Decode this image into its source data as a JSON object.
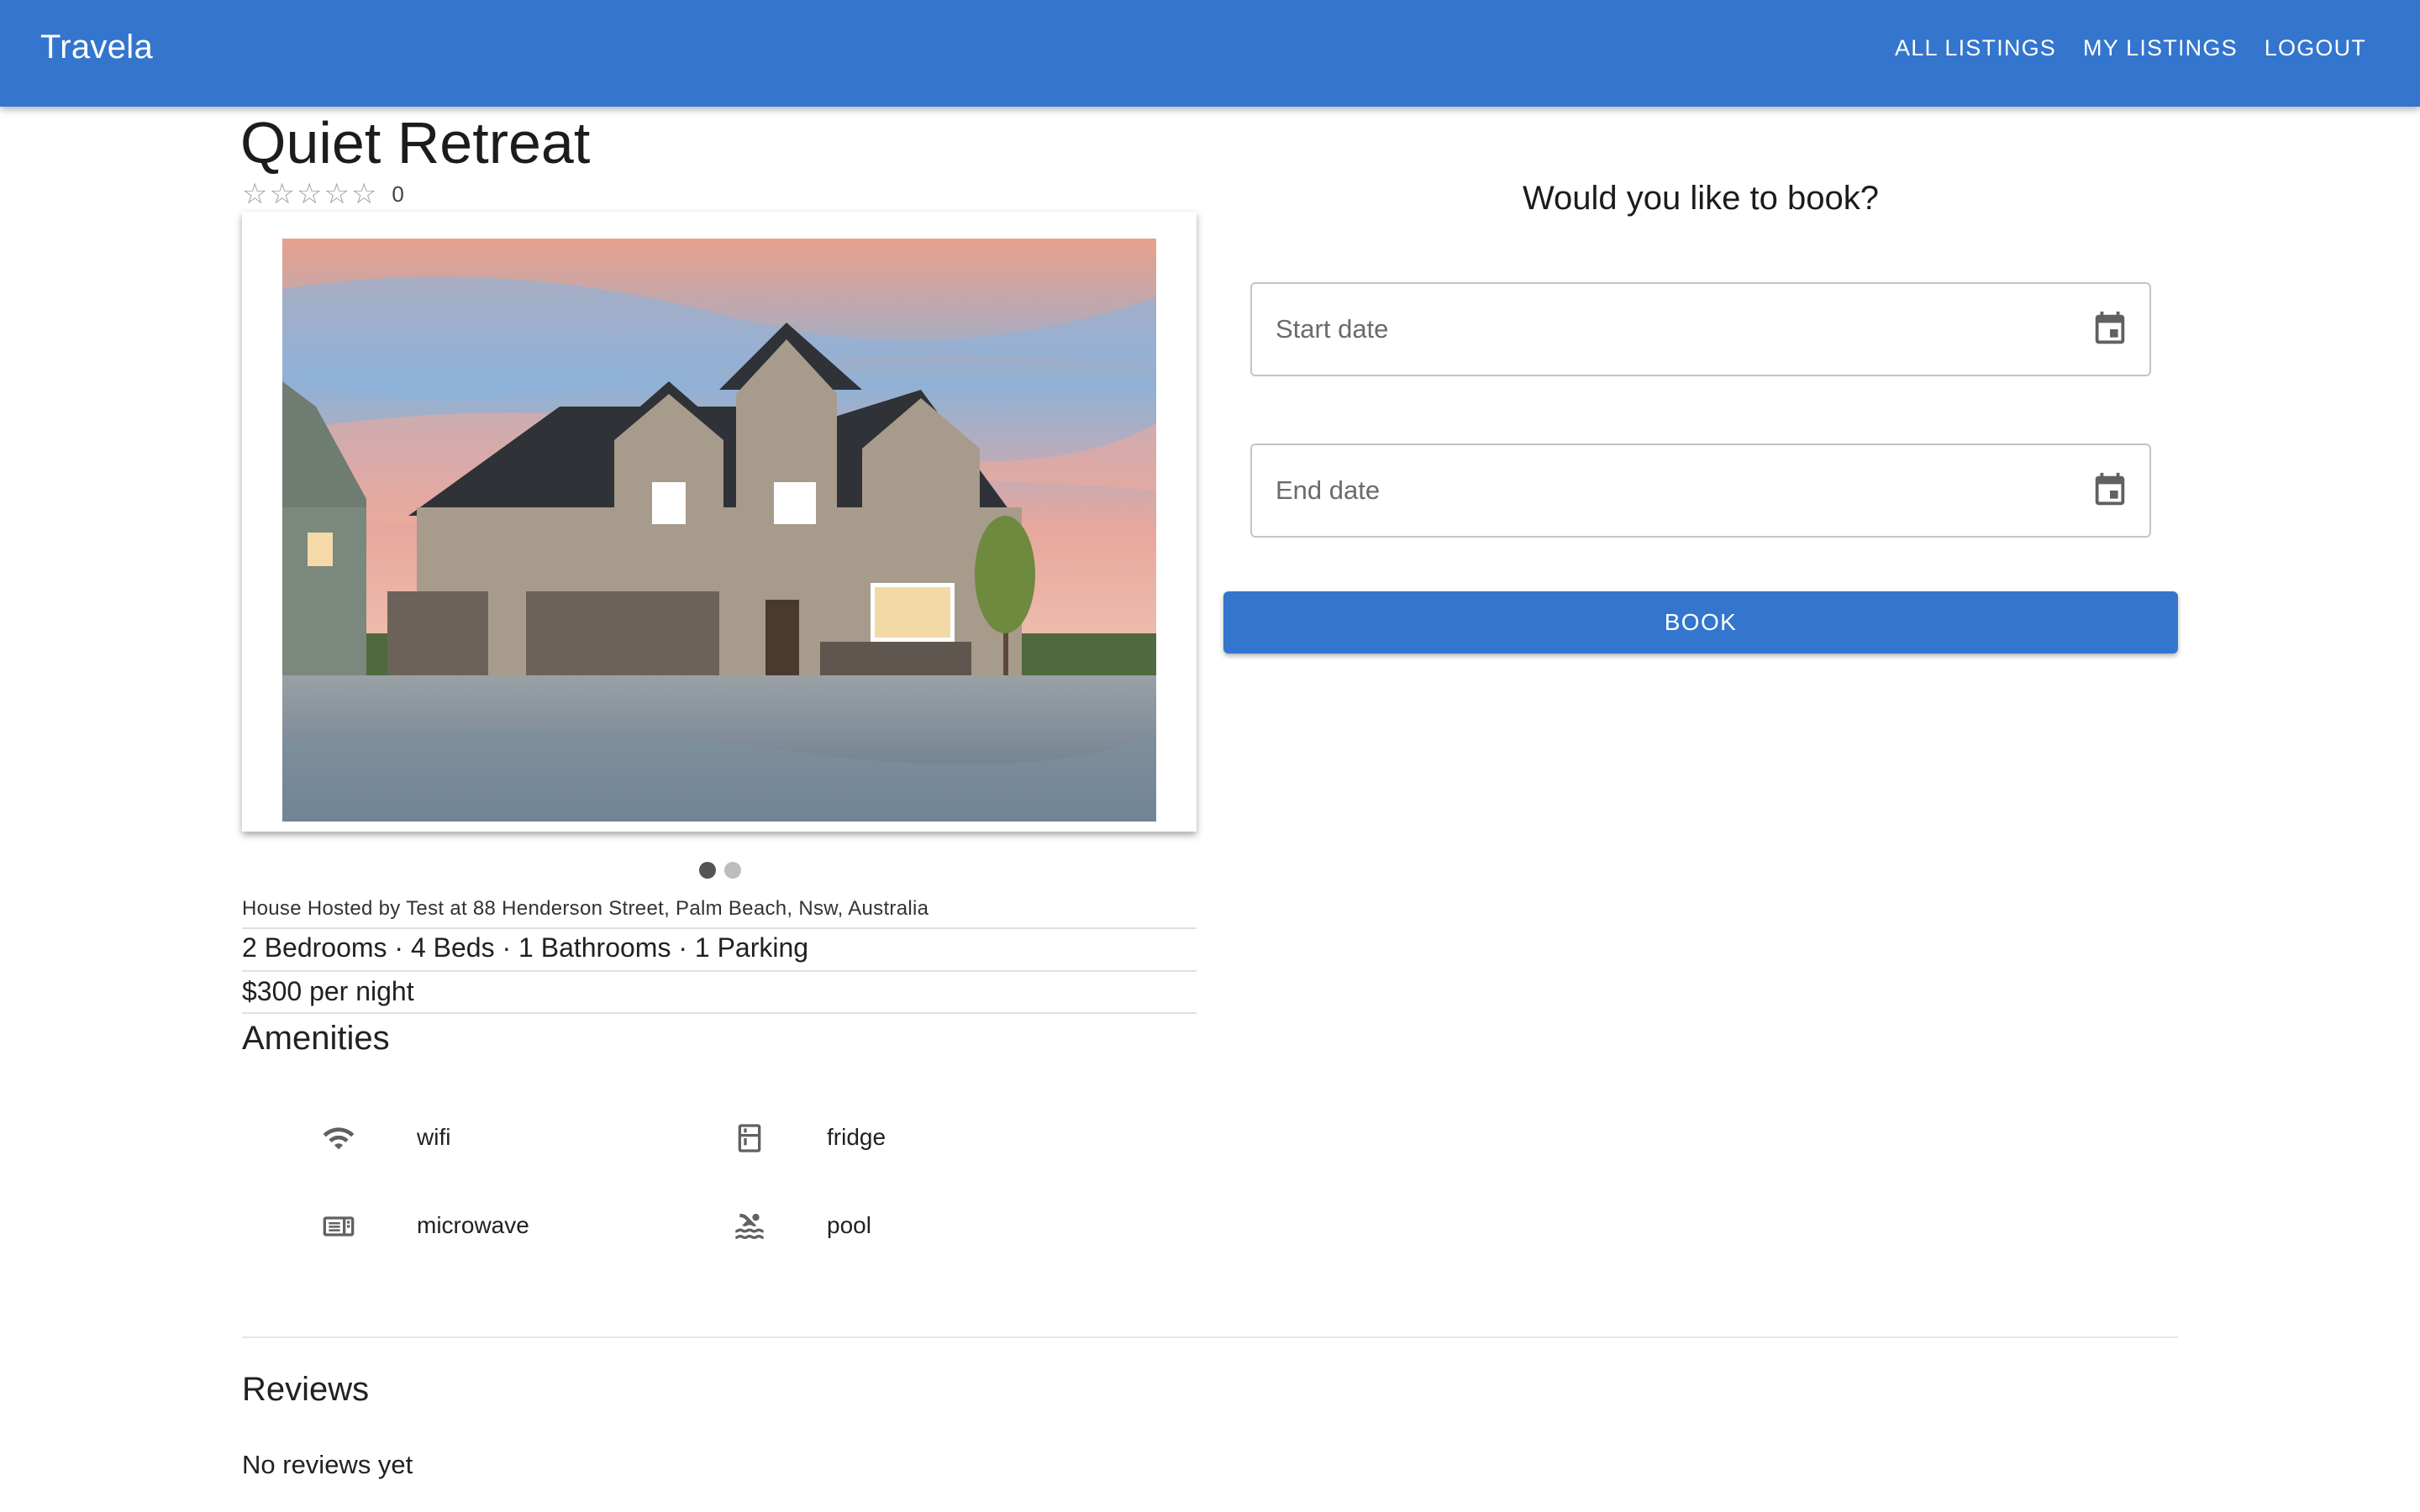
{
  "header": {
    "brand": "Travela",
    "nav": [
      "ALL LISTINGS",
      "MY LISTINGS",
      "LOGOUT"
    ]
  },
  "listing": {
    "title": "Quiet Retreat",
    "rating_stars": 0,
    "rating_count": "0",
    "carousel": {
      "slide_count": 2,
      "active_index": 0
    },
    "host_line": "House Hosted by Test at 88 Henderson Street, Palm Beach, Nsw, Australia",
    "specs": "2 Bedrooms · 4 Beds · 1 Bathrooms · 1 Parking",
    "price": "$300 per night",
    "amenities_title": "Amenities",
    "amenities": [
      {
        "label": "wifi",
        "icon": "wifi-icon"
      },
      {
        "label": "fridge",
        "icon": "fridge-icon"
      },
      {
        "label": "microwave",
        "icon": "microwave-icon"
      },
      {
        "label": "pool",
        "icon": "pool-icon"
      }
    ]
  },
  "booking": {
    "heading": "Would you like to book?",
    "start_placeholder": "Start date",
    "end_placeholder": "End date",
    "book_label": "BOOK"
  },
  "reviews": {
    "title": "Reviews",
    "empty_text": "No reviews yet"
  },
  "colors": {
    "primary": "#3476cd",
    "star_empty": "#9e9e9e",
    "dot_active": "#555555",
    "dot_inactive": "#bdbdbd"
  }
}
